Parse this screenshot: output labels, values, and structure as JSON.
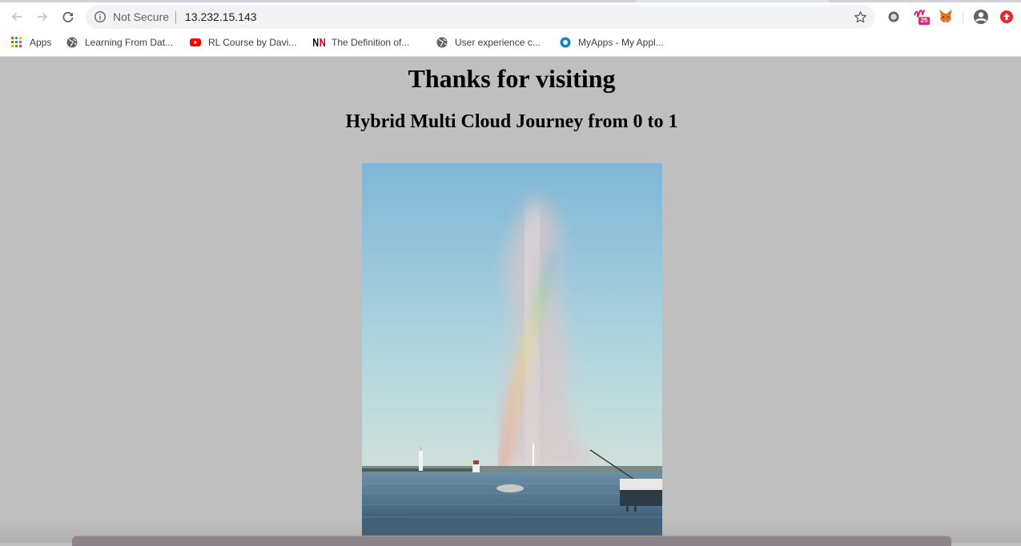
{
  "browser": {
    "security_label": "Not Secure",
    "url": "13.232.15.143",
    "extensions": [
      "record-icon",
      "m25-extension-icon",
      "metamask-fox-icon"
    ],
    "extension_badge": "25"
  },
  "bookmarks": [
    {
      "label": "Apps",
      "icon": "apps-grid-icon"
    },
    {
      "label": "Learning From Dat...",
      "icon": "globe-icon"
    },
    {
      "label": "RL Course by Davi...",
      "icon": "youtube-icon"
    },
    {
      "label": "The Definition of...",
      "icon": "nn-icon"
    },
    {
      "label": "User experience c...",
      "icon": "globe-icon"
    },
    {
      "label": "MyApps - My Appl...",
      "icon": "myapps-icon"
    }
  ],
  "page": {
    "title": "Thanks for visiting",
    "subtitle": "Hybrid Multi Cloud Journey from 0 to 1"
  },
  "colors": {
    "page_background": "#bfbfbf",
    "youtube_red": "#ff0000",
    "nn_red": "#d0021b",
    "myapps_blue": "#0f83c6"
  }
}
